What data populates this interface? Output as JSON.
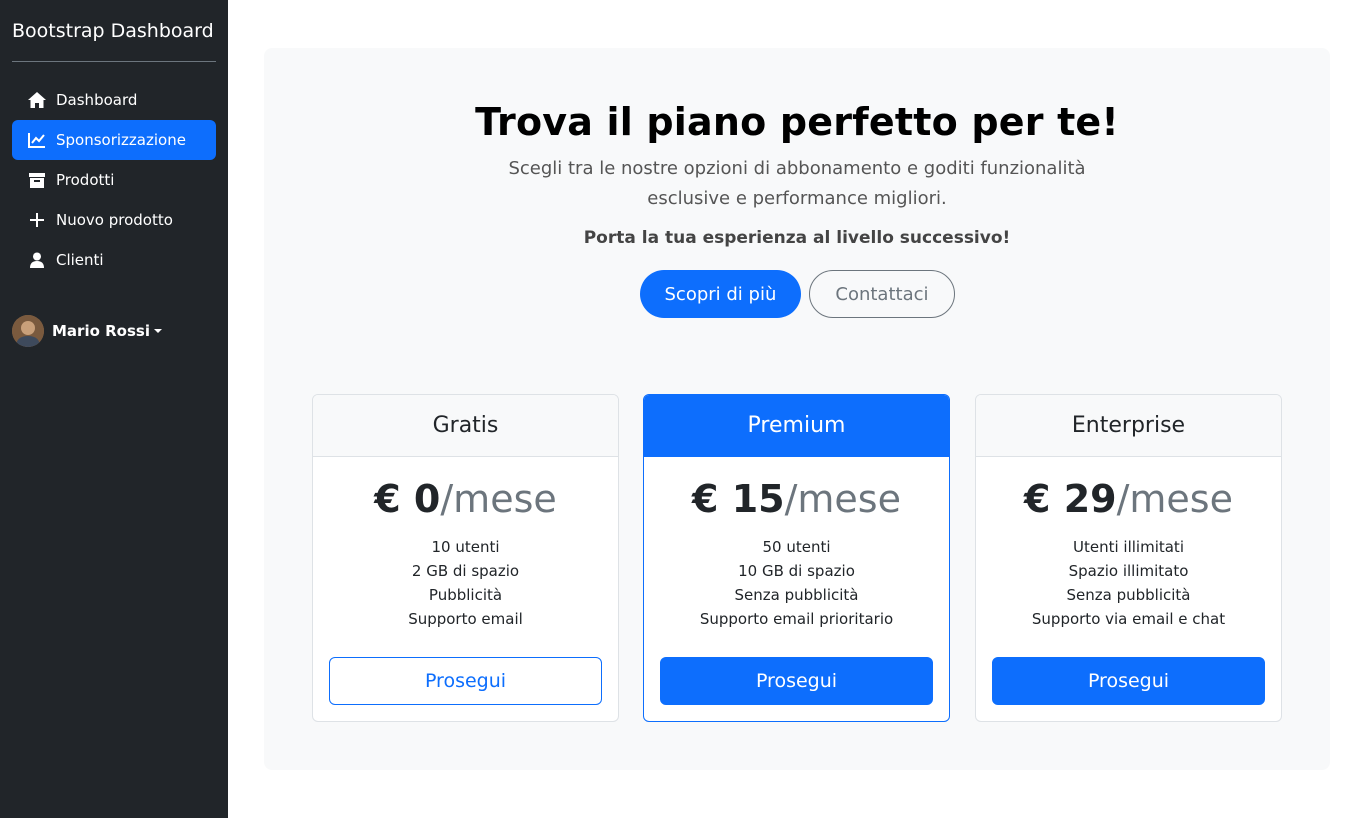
{
  "sidebar": {
    "brand": "Bootstrap Dashboard",
    "items": [
      {
        "label": "Dashboard",
        "icon": "home-icon",
        "active": false
      },
      {
        "label": "Sponsorizzazione",
        "icon": "chart-line-icon",
        "active": true
      },
      {
        "label": "Prodotti",
        "icon": "archive-icon",
        "active": false
      },
      {
        "label": "Nuovo prodotto",
        "icon": "plus-icon",
        "active": false
      },
      {
        "label": "Clienti",
        "icon": "person-icon",
        "active": false
      }
    ],
    "user": {
      "name": "Mario Rossi"
    }
  },
  "hero": {
    "title": "Trova il piano perfetto per te!",
    "lead": "Scegli tra le nostre opzioni di abbonamento e goditi funzionalità esclusive e performance migliori.",
    "subtitle": "Porta la tua esperienza al livello successivo!",
    "primary_button": "Scopri di più",
    "secondary_button": "Contattaci"
  },
  "plans": [
    {
      "name": "Gratis",
      "price": "€ 0",
      "period": "/mese",
      "features": [
        "10 utenti",
        "2 GB di spazio",
        "Pubblicità",
        "Supporto email"
      ],
      "button": "Prosegui"
    },
    {
      "name": "Premium",
      "price": "€ 15",
      "period": "/mese",
      "features": [
        "50 utenti",
        "10 GB di spazio",
        "Senza pubblicità",
        "Supporto email prioritario"
      ],
      "button": "Prosegui"
    },
    {
      "name": "Enterprise",
      "price": "€ 29",
      "period": "/mese",
      "features": [
        "Utenti illimitati",
        "Spazio illimitato",
        "Senza pubblicità",
        "Supporto via email e chat"
      ],
      "button": "Prosegui"
    }
  ],
  "colors": {
    "primary": "#0d6efd",
    "sidebar_bg": "#212529",
    "panel_bg": "#f8f9fa",
    "muted": "#6c757d"
  }
}
